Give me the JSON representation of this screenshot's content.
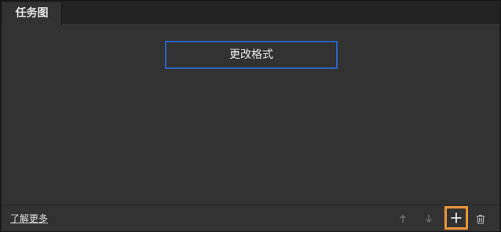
{
  "panel": {
    "tab_label": "任务图"
  },
  "actions": {
    "items": [
      {
        "label": "更改格式"
      }
    ]
  },
  "footer": {
    "learn_more": "了解更多",
    "icons": {
      "move_up": "arrow-up-icon",
      "move_down": "arrow-down-icon",
      "add": "plus-icon",
      "delete": "trash-icon"
    }
  },
  "colors": {
    "panel_bg": "#323232",
    "selected_border": "#2a63c0",
    "focus_highlight": "#e8953a"
  }
}
